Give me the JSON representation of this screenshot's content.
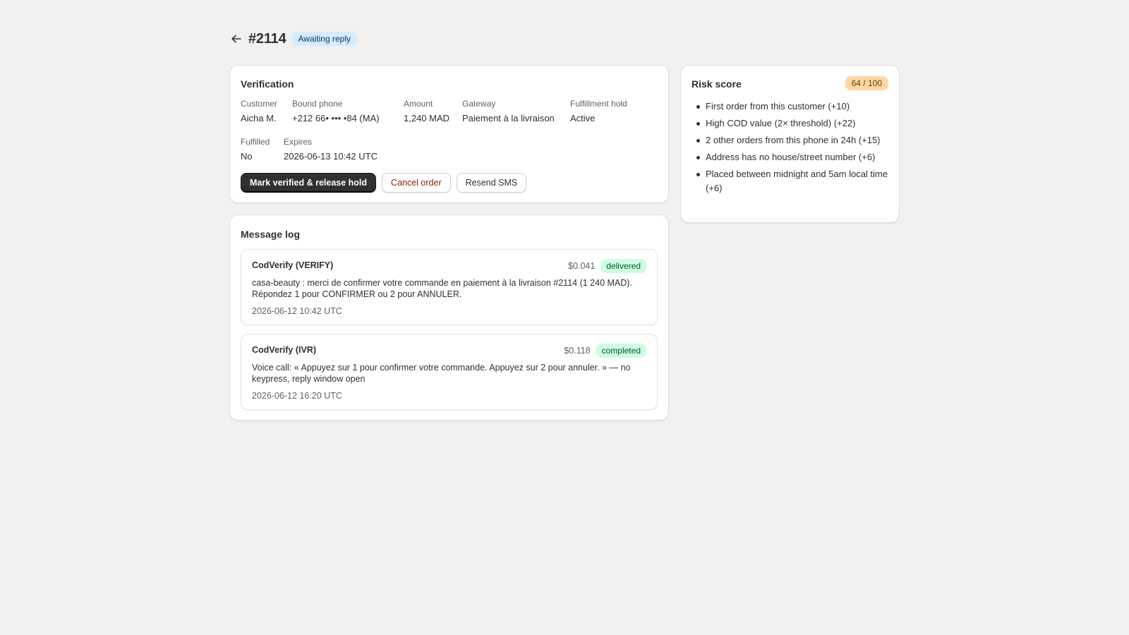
{
  "header": {
    "title": "#2114",
    "status": "Awaiting reply"
  },
  "verification": {
    "title": "Verification",
    "fields": [
      {
        "label": "Customer",
        "value": "Aicha M."
      },
      {
        "label": "Bound phone",
        "value": "+212 66• ••• •84 (MA)"
      },
      {
        "label": "Amount",
        "value": "1,240 MAD"
      },
      {
        "label": "Gateway",
        "value": "Paiement à la livraison"
      },
      {
        "label": "Fulfillment hold",
        "value": "Active"
      },
      {
        "label": "Fulfilled",
        "value": "No"
      },
      {
        "label": "Expires",
        "value": "2026-06-13 10:42 UTC"
      }
    ],
    "buttons": {
      "primary": "Mark verified & release hold",
      "cancel": "Cancel order",
      "resend": "Resend SMS"
    }
  },
  "message_log": {
    "title": "Message log",
    "messages": [
      {
        "sender": "CodVerify (VERIFY)",
        "cost": "$0.041",
        "status": "delivered",
        "body": "casa-beauty : merci de confirmer votre commande en paiement à la livraison #2114 (1 240 MAD). Répondez 1 pour CONFIRMER ou 2 pour ANNULER.",
        "time": "2026-06-12 10:42 UTC"
      },
      {
        "sender": "CodVerify (IVR)",
        "cost": "$0.118",
        "status": "completed",
        "body": "Voice call: « Appuyez sur 1 pour confirmer votre commande. Appuyez sur 2 pour annuler. » — no keypress, reply window open",
        "time": "2026-06-12 16:20 UTC"
      }
    ]
  },
  "risk": {
    "title": "Risk score",
    "score": "64 / 100",
    "factors": [
      "First order from this customer (+10)",
      "High COD value (2× threshold) (+22)",
      "2 other orders from this phone in 24h (+15)",
      "Address has no house/street number (+6)",
      "Placed between midnight and 5am local time (+6)"
    ]
  },
  "colors": {
    "background": "#f1f1f1",
    "status_pill": "#d5ebff",
    "success_badge": "#cdfee1",
    "risk_badge": "#ffd6a4",
    "critical_text": "#8e1f0b"
  }
}
